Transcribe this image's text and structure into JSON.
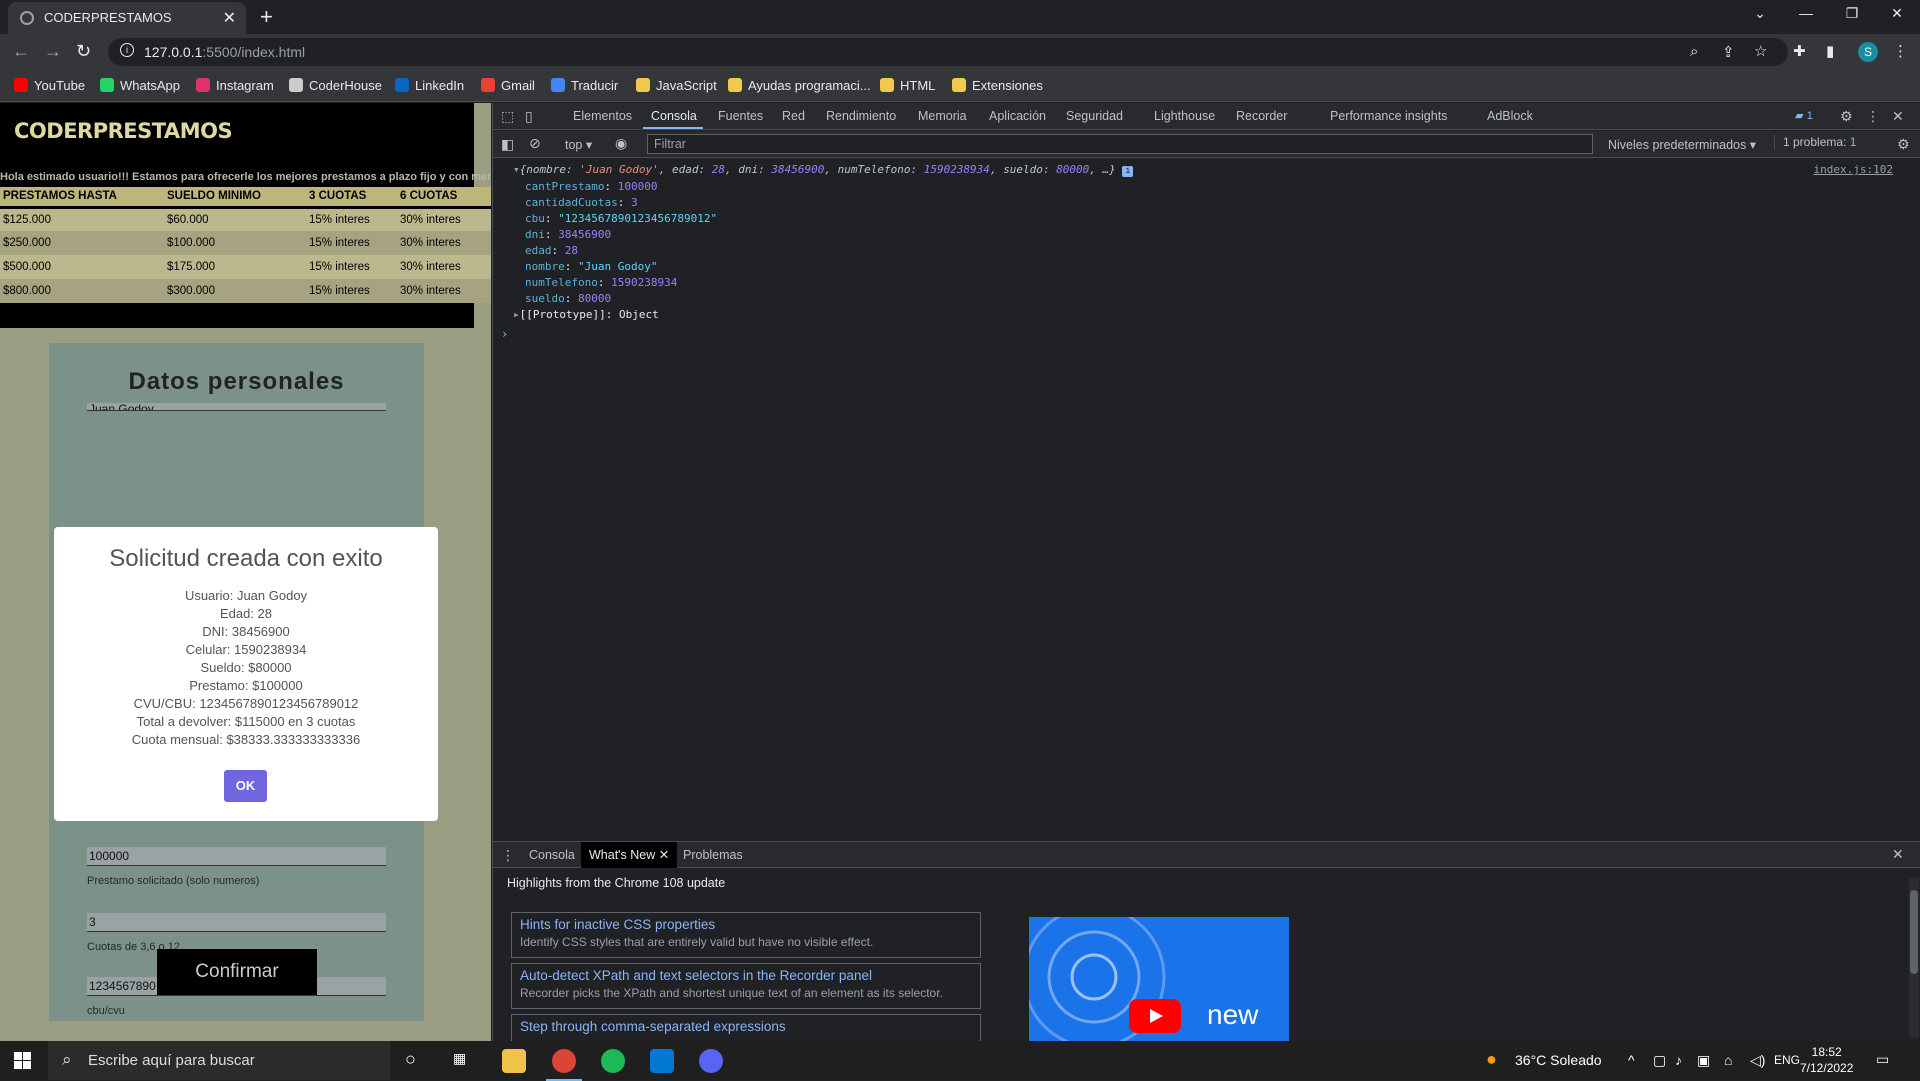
{
  "browser": {
    "tab_title": "CODERPRESTAMOS",
    "url_host": "127.0.0.1",
    "url_rest": ":5500/index.html",
    "bookmarks": [
      {
        "label": "YouTube",
        "color": "#ff0000"
      },
      {
        "label": "WhatsApp",
        "color": "#25d366"
      },
      {
        "label": "Instagram",
        "color": "#e1306c"
      },
      {
        "label": "CoderHouse",
        "color": "#cccccc"
      },
      {
        "label": "LinkedIn",
        "color": "#0a66c2"
      },
      {
        "label": "Gmail",
        "color": "#ea4335"
      },
      {
        "label": "Traducir",
        "color": "#4285f4"
      },
      {
        "label": "JavaScript",
        "color": "#f2c94c"
      },
      {
        "label": "Ayudas programaci...",
        "color": "#f2c94c"
      },
      {
        "label": "HTML",
        "color": "#f2c94c"
      },
      {
        "label": "Extensiones",
        "color": "#f2c94c"
      }
    ],
    "profile_initial": "S"
  },
  "page": {
    "brand": "CODERPRESTAMOS",
    "marquee": "Hola estimado usuario!!! Estamos para ofrecerle los mejores prestamos a plazo fijo y con menor in",
    "rates_headers": [
      "PRESTAMOS HASTA",
      "SUELDO MINIMO",
      "3 CUOTAS",
      "6 CUOTAS"
    ],
    "rates_rows": [
      [
        "$125.000",
        "$60.000",
        "15% interes",
        "30% interes"
      ],
      [
        "$250.000",
        "$100.000",
        "15% interes",
        "30% interes"
      ],
      [
        "$500.000",
        "$175.000",
        "15% interes",
        "30% interes"
      ],
      [
        "$800.000",
        "$300.000",
        "15% interes",
        "30% interes"
      ]
    ],
    "form": {
      "title": "Datos personales",
      "name_value": "Juan Godoy",
      "prestamo_value": "100000",
      "prestamo_help": "Prestamo solicitado (solo numeros)",
      "cuotas_value": "3",
      "cuotas_help": "Cuotas de 3,6 o 12",
      "cbu_value": "12345678901234567890​12",
      "cbu_help": "cbu/cvu",
      "confirm_label": "Confirmar"
    },
    "modal": {
      "title": "Solicitud creada con exito",
      "lines": [
        "Usuario: Juan Godoy",
        "Edad: 28",
        "DNI: 38456900",
        "Celular: 1590238934",
        "Sueldo: $80000",
        "Prestamo: $100000",
        "CVU/CBU: 1234567890123456789012",
        "Total a devolver: $115000 en 3 cuotas",
        "Cuota mensual: $38333.333333333336"
      ],
      "ok_label": "OK"
    }
  },
  "devtools": {
    "tabs": [
      "Elementos",
      "Consola",
      "Fuentes",
      "Red",
      "Rendimiento",
      "Memoria",
      "Aplicación",
      "Seguridad",
      "Lighthouse",
      "Recorder",
      "Performance insights",
      "AdBlock"
    ],
    "active_tab": "Consola",
    "messages_badge": "1",
    "context": "top",
    "filter_placeholder": "Filtrar",
    "levels": "Niveles predeterminados",
    "problems": "1 problema:",
    "problems_count": "1",
    "source_link": "index.js:102",
    "object_summary": {
      "nombre": "'Juan Godoy'",
      "edad": "28",
      "dni": "38456900",
      "numTelefono": "1590238934",
      "sueldo": "80000",
      "tail": ", …}"
    },
    "props": [
      {
        "key": "cantPrestamo",
        "value": "100000",
        "type": "n"
      },
      {
        "key": "cantidadCuotas",
        "value": "3",
        "type": "n"
      },
      {
        "key": "cbu",
        "value": "\"1234567890123456789012\"",
        "type": "s"
      },
      {
        "key": "dni",
        "value": "38456900",
        "type": "n"
      },
      {
        "key": "edad",
        "value": "28",
        "type": "n"
      },
      {
        "key": "nombre",
        "value": "\"Juan Godoy\"",
        "type": "s"
      },
      {
        "key": "numTelefono",
        "value": "1590238934",
        "type": "n"
      },
      {
        "key": "sueldo",
        "value": "80000",
        "type": "n"
      }
    ],
    "prototype": "[[Prototype]]: Object",
    "drawer": {
      "tabs": [
        "Consola",
        "What's New",
        "Problemas"
      ],
      "active_tab": "What's New",
      "headline": "Highlights from the Chrome 108 update",
      "cards": [
        {
          "title": "Hints for inactive CSS properties",
          "desc": "Identify CSS styles that are entirely valid but have no visible effect."
        },
        {
          "title": "Auto-detect XPath and text selectors in the Recorder panel",
          "desc": "Recorder picks the XPath and shortest unique text of an element as its selector."
        },
        {
          "title": "Step through comma-separated expressions",
          "desc": ""
        }
      ],
      "video_text": "new"
    }
  },
  "taskbar": {
    "search_placeholder": "Escribe aquí para buscar",
    "weather": "36°C  Soleado",
    "language": "ENG",
    "time": "18:52",
    "date": "7/12/2022"
  }
}
